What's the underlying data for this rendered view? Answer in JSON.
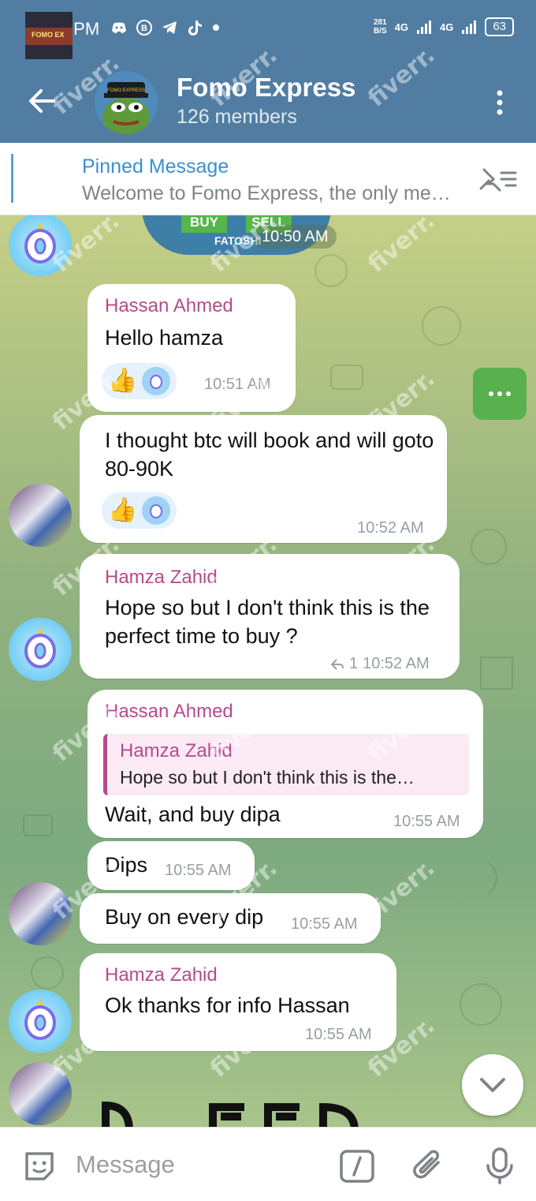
{
  "status_bar": {
    "time": "12:36 PM",
    "net_speed": "281",
    "net_unit": "B/S",
    "signal1": "4G",
    "signal2": "4G",
    "battery": "63"
  },
  "header": {
    "title": "Fomo Express",
    "subtitle": "126 members",
    "avatar_caption": "FOMO EXPRESS"
  },
  "pinned": {
    "label": "Pinned Message",
    "text": "Welcome to Fomo Express, the only me…",
    "thumb_caption": "FOMO EX"
  },
  "sticker": {
    "labels": [
      "BUY",
      "SELL"
    ],
    "caption": "FATOSHI"
  },
  "messages": [
    {
      "time": "10:50 AM"
    },
    {
      "sender": "Hassan Ahmed",
      "text": "Hello hamza",
      "time": "10:51 AM"
    },
    {
      "text": "I thought btc will book and will goto 80-90K",
      "time": "10:52 AM"
    },
    {
      "sender": "Hamza Zahid",
      "text": "Hope so  but I don't think this is the perfect time to buy ?",
      "time": "10:52 AM",
      "replies": "1"
    },
    {
      "sender": "Hassan Ahmed",
      "reply_to": "Hamza Zahid",
      "reply_text": "Hope so  but I don't think this is the…",
      "text": "Wait, and buy dipa",
      "time": "10:55 AM"
    },
    {
      "text": "Dips",
      "time": "10:55 AM"
    },
    {
      "text": "Buy on every dip",
      "time": "10:55 AM"
    },
    {
      "sender": "Hamza Zahid",
      "text": "Ok thanks for info Hassan",
      "time": "10:55 AM"
    }
  ],
  "input": {
    "placeholder": "Message"
  },
  "watermark": "fiverr.",
  "colors": {
    "header": "#517da2",
    "sender": "#b54b8d",
    "accent": "#3a8fd0"
  }
}
